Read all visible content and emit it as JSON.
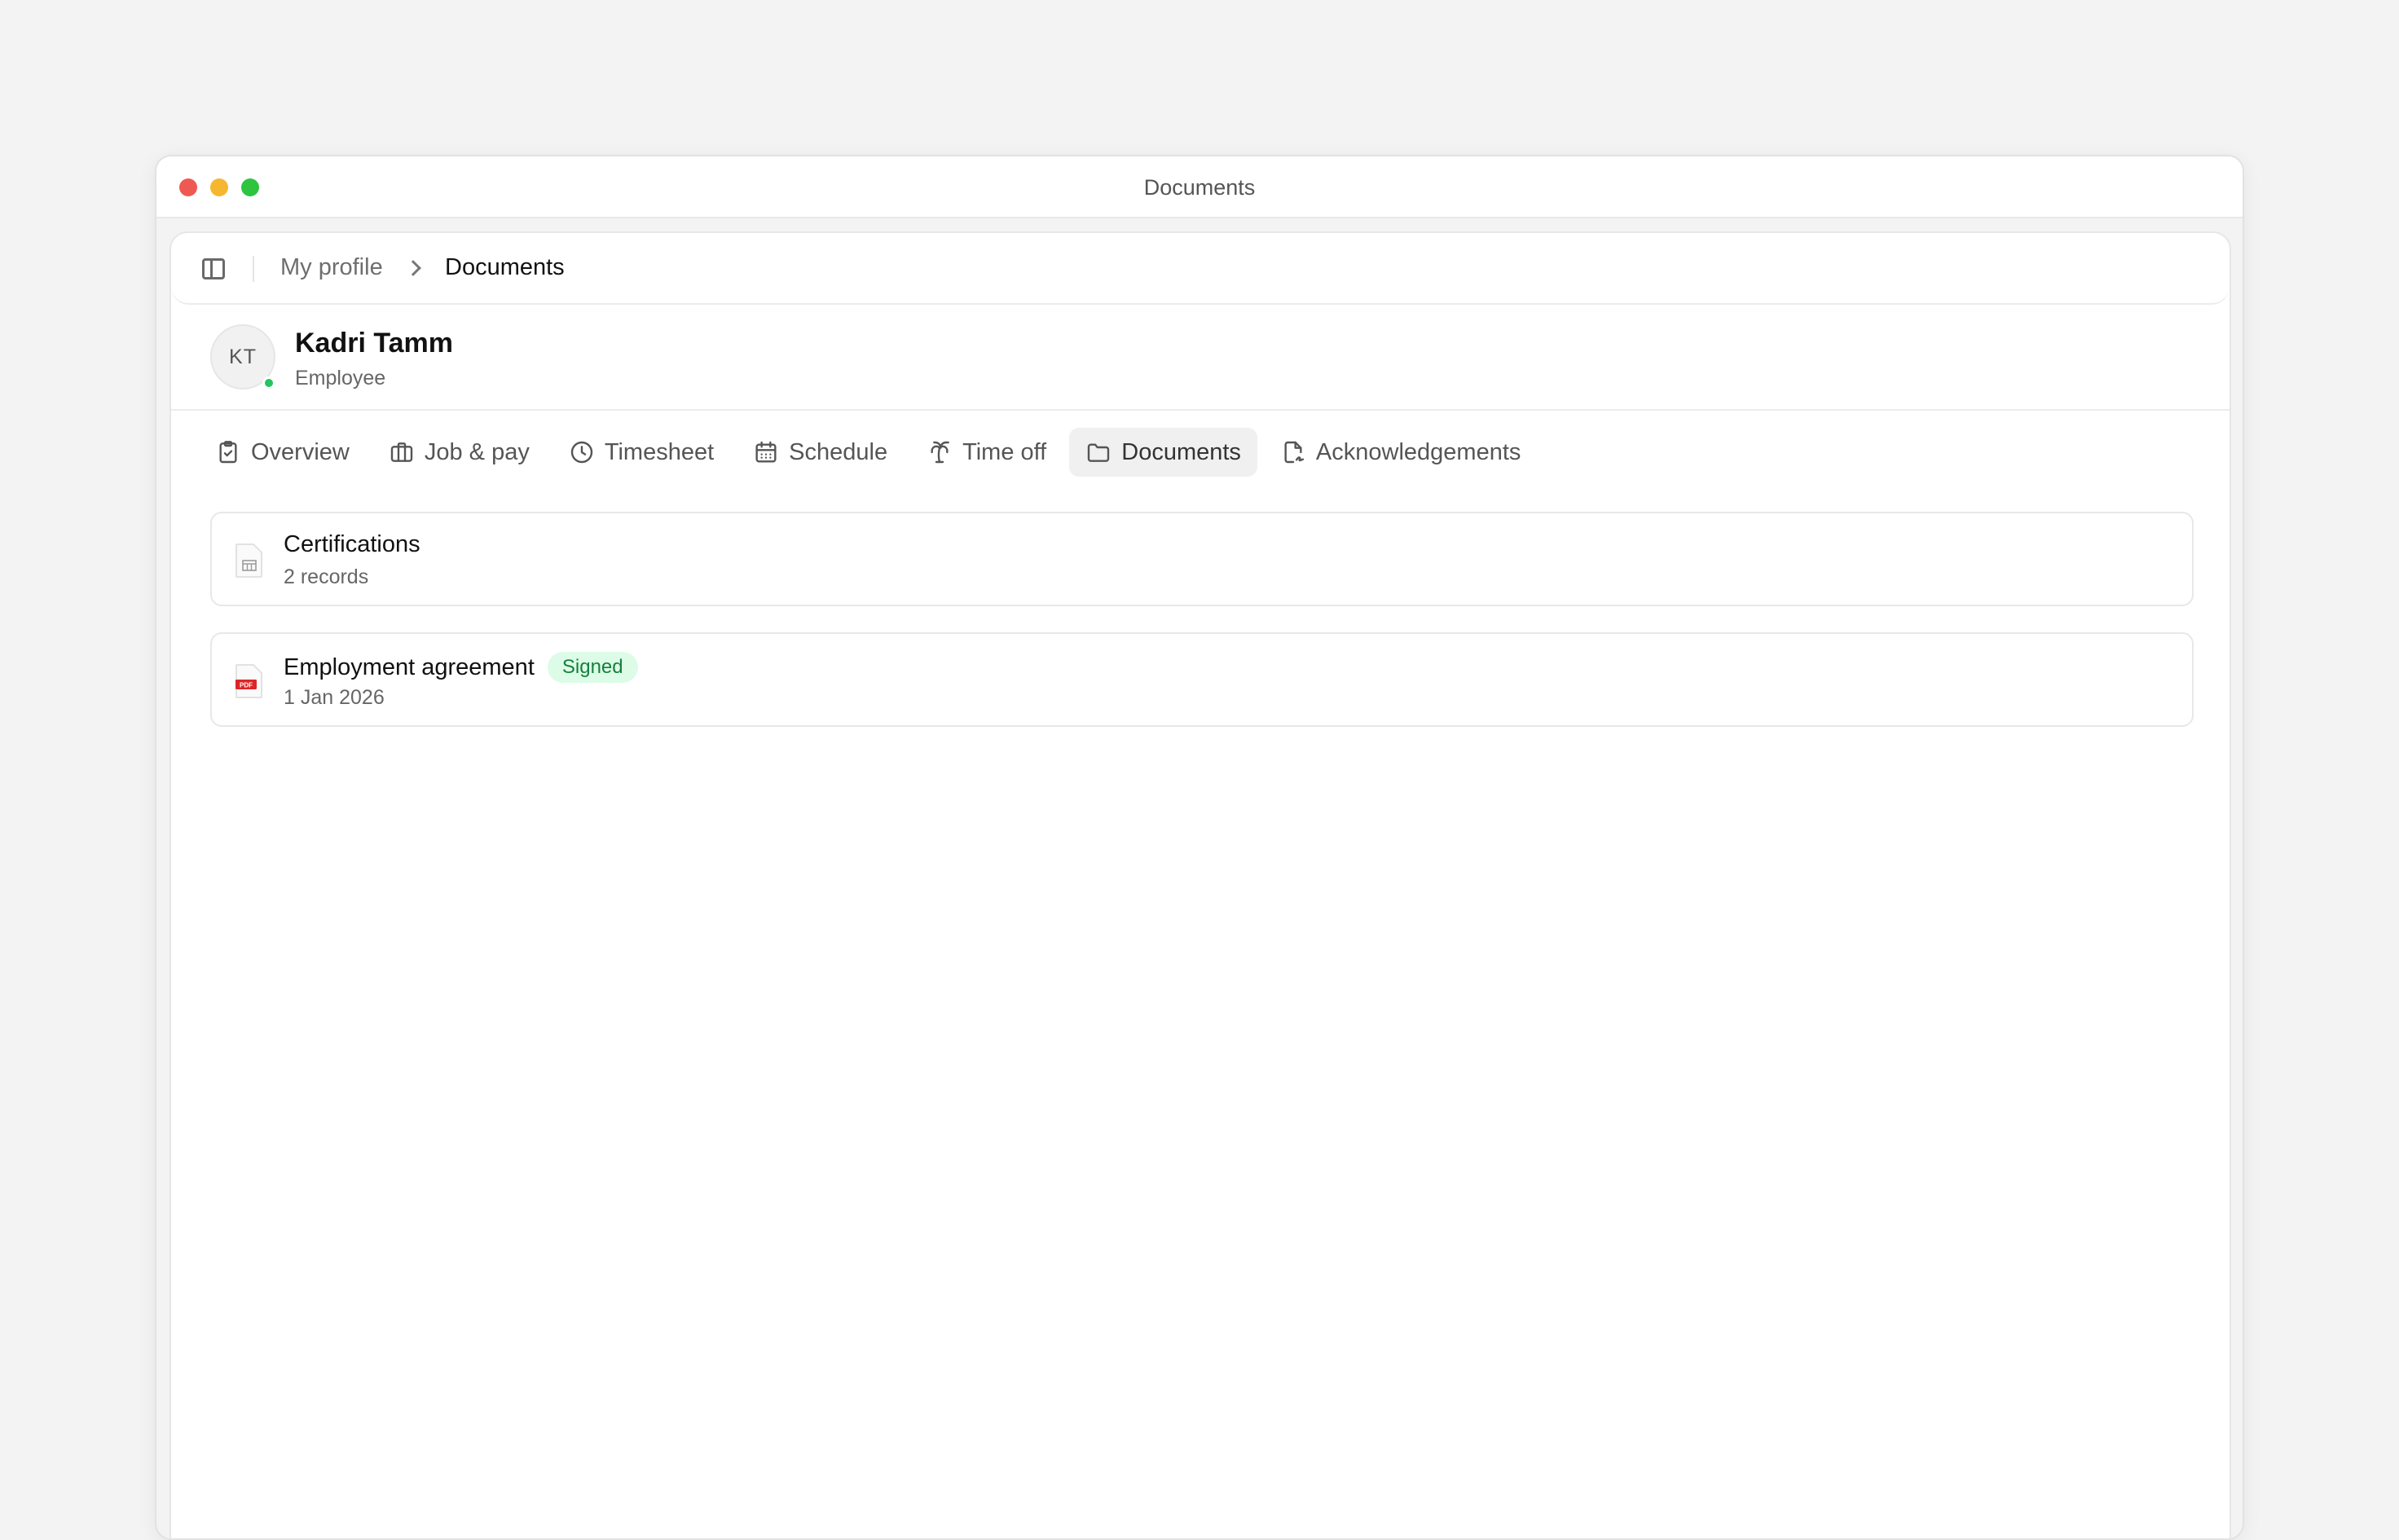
{
  "window": {
    "title": "Documents"
  },
  "breadcrumb": {
    "parent": "My profile",
    "current": "Documents"
  },
  "profile": {
    "initials": "KT",
    "name": "Kadri Tamm",
    "role": "Employee",
    "status_color": "#22c55e"
  },
  "tabs": [
    {
      "label": "Overview",
      "icon": "clipboard-check-icon"
    },
    {
      "label": "Job & pay",
      "icon": "briefcase-icon"
    },
    {
      "label": "Timesheet",
      "icon": "clock-icon"
    },
    {
      "label": "Schedule",
      "icon": "calendar-icon"
    },
    {
      "label": "Time off",
      "icon": "palm-tree-icon"
    },
    {
      "label": "Documents",
      "icon": "folder-icon",
      "active": true
    },
    {
      "label": "Acknowledgements",
      "icon": "file-signature-icon"
    }
  ],
  "documents": [
    {
      "title": "Certifications",
      "subtitle": "2 records",
      "icon": "spreadsheet-file-icon"
    },
    {
      "title": "Employment agreement",
      "subtitle": "1 Jan 2026",
      "badge": "Signed",
      "icon": "pdf-file-icon",
      "file_label": "PDF"
    }
  ],
  "colors": {
    "badge_bg": "#dcfce7",
    "badge_text": "#15803d",
    "pdf_red": "#dc2626"
  }
}
